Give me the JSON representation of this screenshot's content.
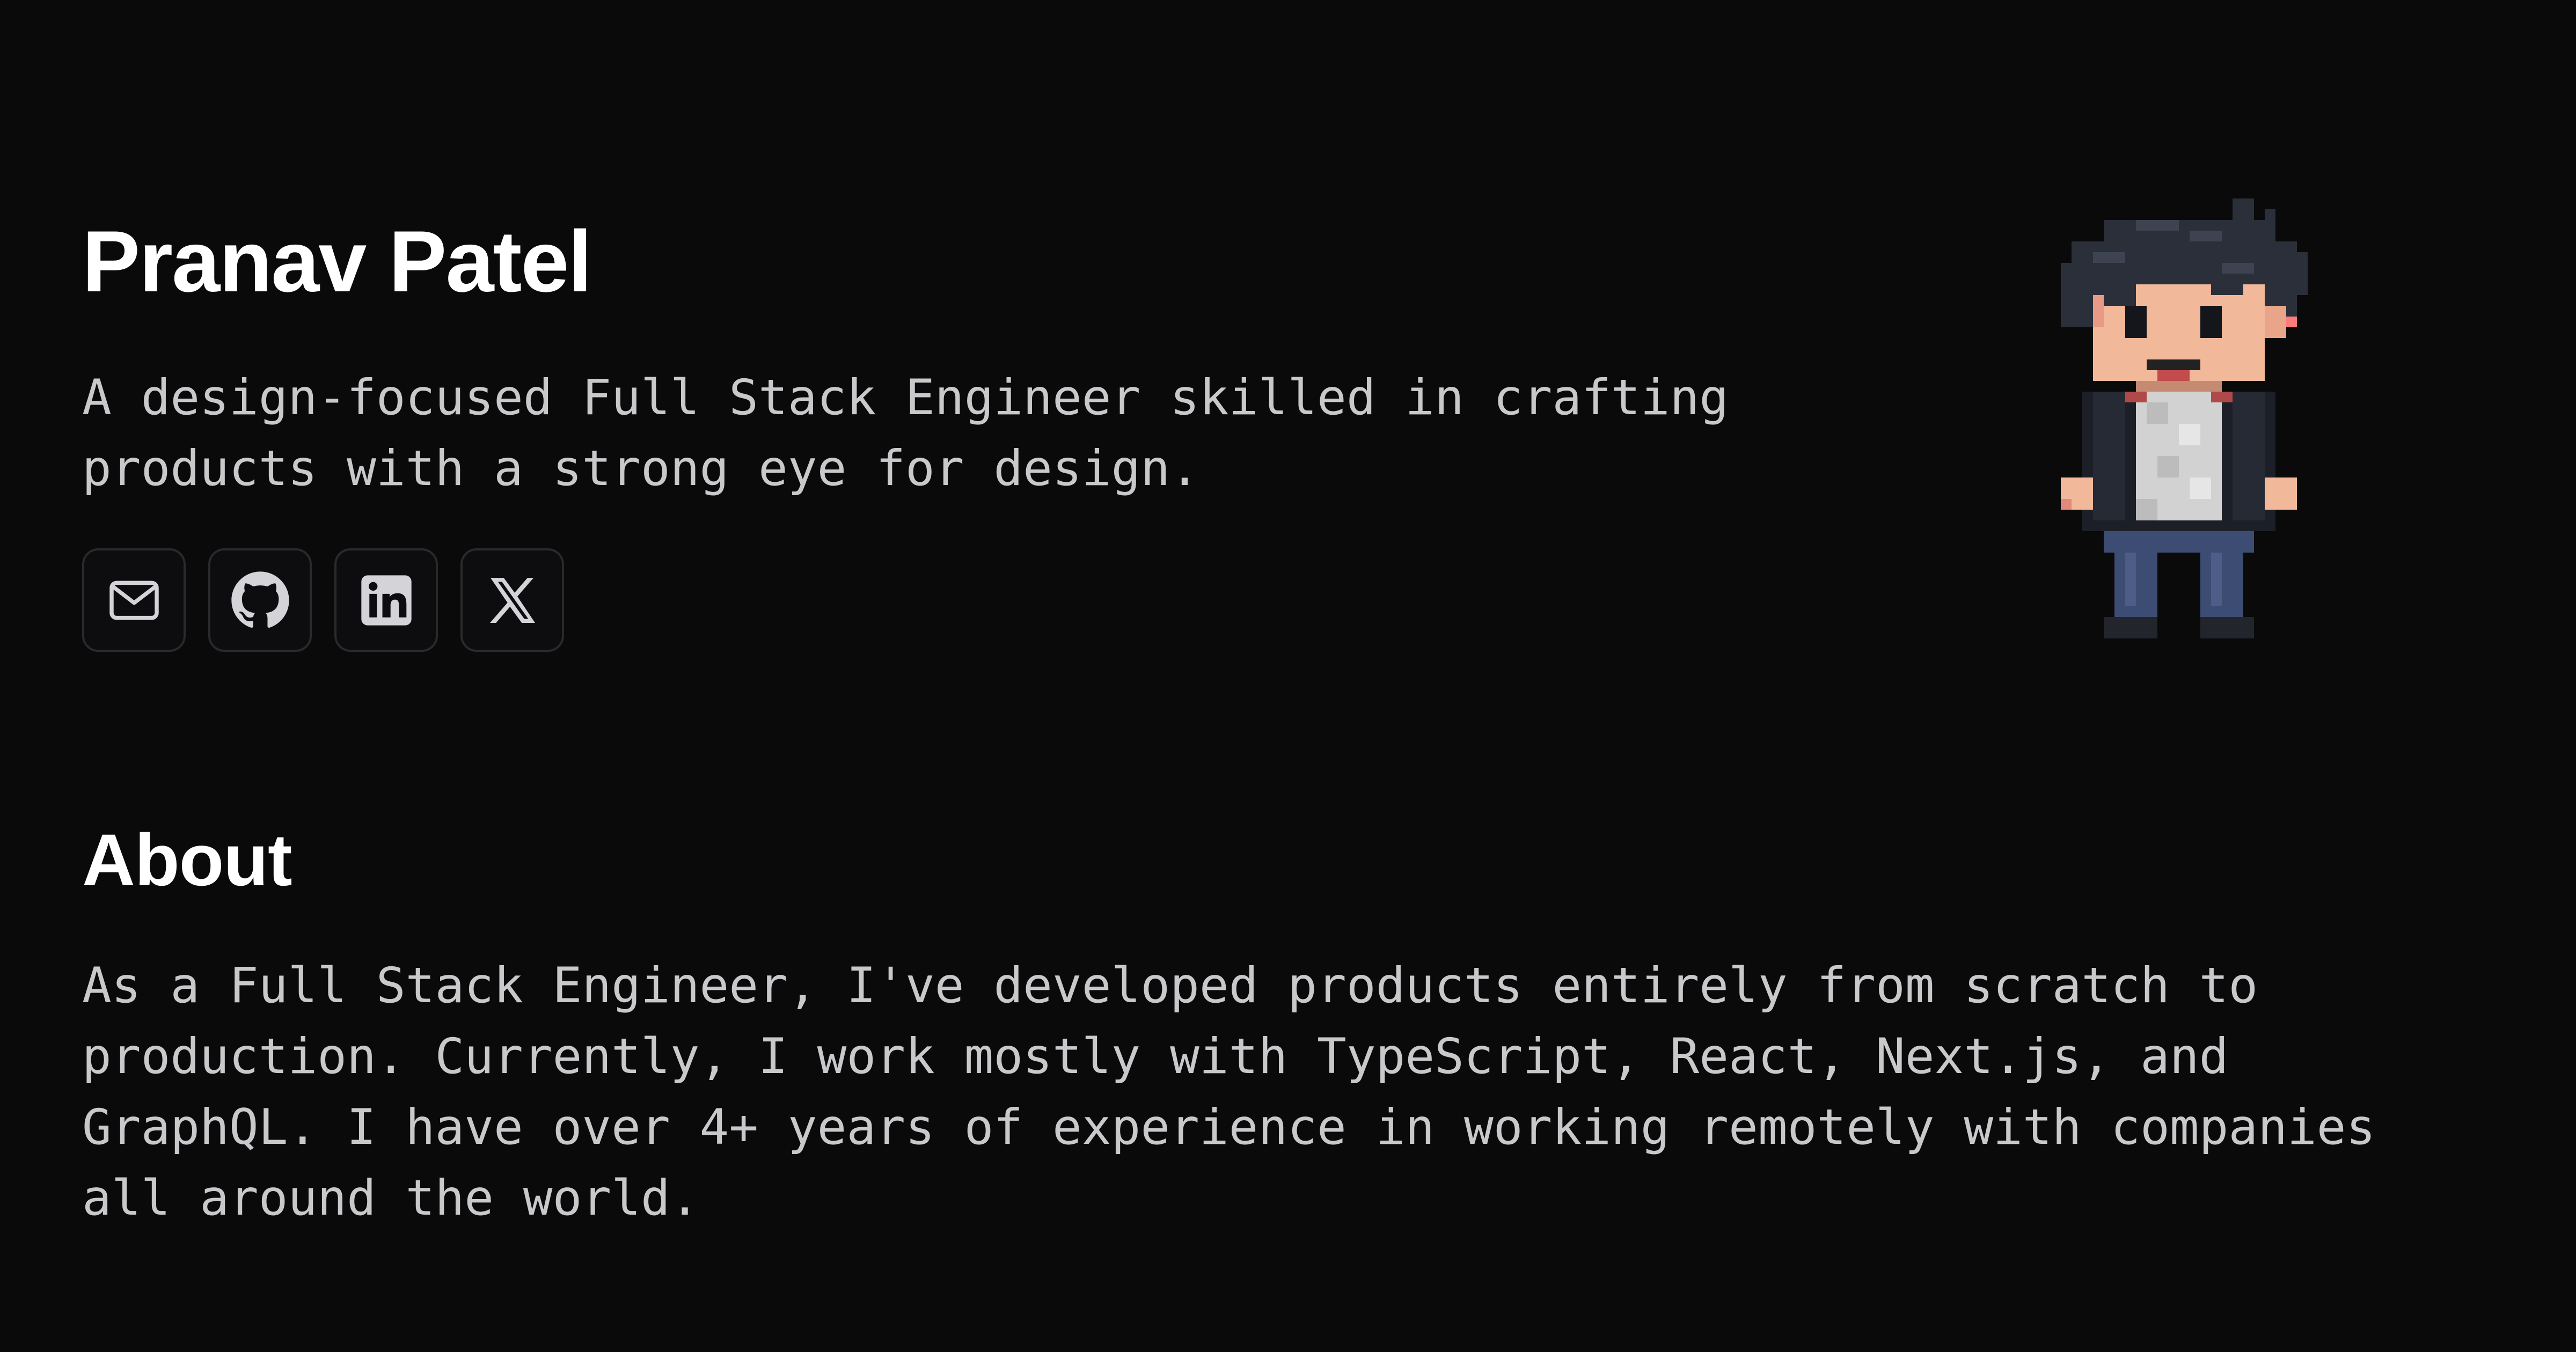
{
  "hero": {
    "name": "Pranav Patel",
    "tagline": "A design-focused Full Stack Engineer skilled in crafting\nproducts with a strong eye for design."
  },
  "socials": [
    {
      "icon": "mail-icon"
    },
    {
      "icon": "github-icon"
    },
    {
      "icon": "linkedin-icon"
    },
    {
      "icon": "x-icon"
    }
  ],
  "about": {
    "title": "About",
    "text": "As a Full Stack Engineer, I've developed products entirely from scratch to\nproduction. Currently, I work mostly with TypeScript, React, Next.js, and\nGraphQL. I have over 4+ years of experience in working remotely with companies\nall around the world."
  },
  "colors": {
    "background": "#0a0a0b",
    "heading": "#ffffff",
    "body_text": "#c9c9cc",
    "button_border": "#2a2a2d",
    "icon": "#d4d4d8"
  }
}
